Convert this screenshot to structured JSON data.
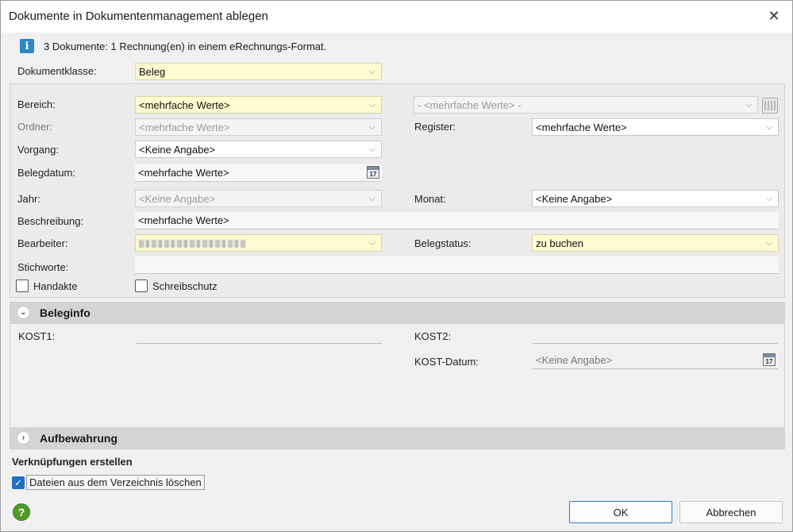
{
  "window": {
    "title": "Dokumente in Dokumentenmanagement ablegen"
  },
  "info": {
    "text": "3 Dokumente: 1 Rechnung(en) in einem eRechnungs-Format."
  },
  "dokumentklasse": {
    "label": "Dokumentklasse:",
    "value": "Beleg"
  },
  "form": {
    "bereich": {
      "label": "Bereich:",
      "value": "<mehrfache Werte>"
    },
    "bereich_right": {
      "value": "- <mehrfache Werte> -"
    },
    "ordner": {
      "label": "Ordner:",
      "value": "<mehrfache Werte>"
    },
    "register": {
      "label": "Register:",
      "value": "<mehrfache Werte>"
    },
    "vorgang": {
      "label": "Vorgang:",
      "value": "<Keine Angabe>"
    },
    "belegdatum": {
      "label": "Belegdatum:",
      "value": "<mehrfache Werte>"
    },
    "jahr": {
      "label": "Jahr:",
      "value": "<Keine Angabe>"
    },
    "monat": {
      "label": "Monat:",
      "value": "<Keine Angabe>"
    },
    "beschreibung": {
      "label": "Beschreibung:",
      "value": "<mehrfache Werte>"
    },
    "bearbeiter": {
      "label": "Bearbeiter:"
    },
    "belegstatus": {
      "label": "Belegstatus:",
      "value": "zu buchen"
    },
    "stichworte": {
      "label": "Stichworte:",
      "value": ""
    },
    "handakte": {
      "label": "Handakte",
      "checked": false
    },
    "schreibschutz": {
      "label": "Schreibschutz",
      "checked": false
    }
  },
  "beleginfo": {
    "title": "Beleginfo",
    "kost1": {
      "label": "KOST1:",
      "value": ""
    },
    "kost2": {
      "label": "KOST2:",
      "value": ""
    },
    "kost_datum": {
      "label": "KOST-Datum:",
      "value": "<Keine Angabe>"
    }
  },
  "aufbewahrung": {
    "title": "Aufbewahrung"
  },
  "verknuepfungen": {
    "title": "Verknüpfungen erstellen"
  },
  "dateien_loeschen": {
    "label": "Dateien aus dem Verzeichnis löschen",
    "checked": true
  },
  "buttons": {
    "ok": "OK",
    "cancel": "Abbrechen"
  },
  "icons": {
    "info": "info-icon",
    "help": "help-icon",
    "close": "close-icon",
    "calendar": "calendar-icon",
    "calendar_date": "17",
    "chevron_down": "chevron-down-icon",
    "chevron_expanded": "⌄",
    "chevron_collapsed": "›",
    "check": "✓",
    "dd_glyph": "⌵"
  },
  "colors": {
    "required_field": "#fdfbd0",
    "accent": "#1f6fc4",
    "info_icon": "#2f86c8",
    "help_icon": "#4f9a2a"
  }
}
